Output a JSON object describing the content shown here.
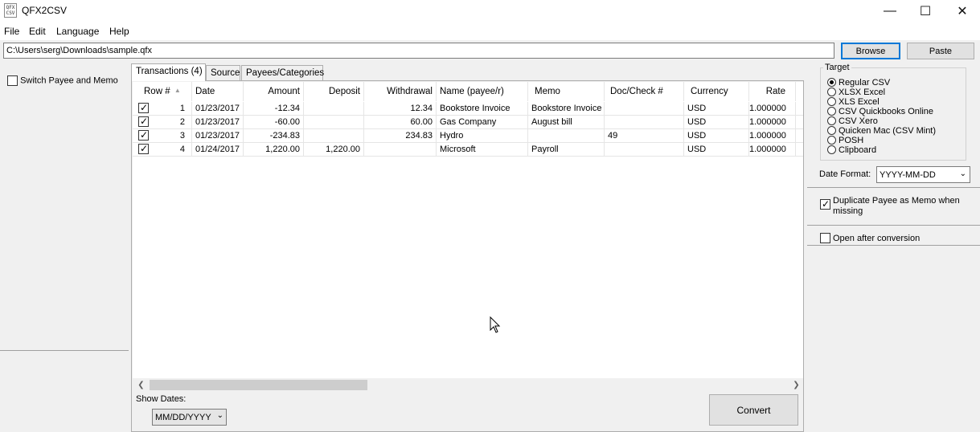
{
  "window": {
    "title": "QFX2CSV",
    "icon_text": "QFX CSV",
    "min_glyph": "—",
    "max_glyph": "☐",
    "close_glyph": "✕"
  },
  "menu": [
    "File",
    "Edit",
    "Language",
    "Help"
  ],
  "toolbar": {
    "path_value": "C:\\Users\\serg\\Downloads\\sample.qfx",
    "browse_label": "Browse",
    "paste_label": "Paste"
  },
  "left_panel": {
    "switch_label": "Switch Payee and Memo",
    "switch_checked": false
  },
  "tabs": [
    {
      "label": "Transactions (4)",
      "active": true
    },
    {
      "label": "Source",
      "active": false
    },
    {
      "label": "Payees/Categories",
      "active": false
    }
  ],
  "grid": {
    "columns": [
      "Row #",
      "Date",
      "Amount",
      "Deposit",
      "Withdrawal",
      "Name (payee/r)",
      "Memo",
      "Doc/Check #",
      "Currency",
      "Rate"
    ],
    "sort_glyph": "▲",
    "rows": [
      {
        "checked": true,
        "row": "1",
        "date": "01/23/2017",
        "amount": "-12.34",
        "deposit": "",
        "withdrawal": "12.34",
        "name": "Bookstore Invoice",
        "memo": "Bookstore Invoice",
        "doc": "",
        "currency": "USD",
        "rate": "1.000000"
      },
      {
        "checked": true,
        "row": "2",
        "date": "01/23/2017",
        "amount": "-60.00",
        "deposit": "",
        "withdrawal": "60.00",
        "name": "Gas Company",
        "memo": "August bill",
        "doc": "",
        "currency": "USD",
        "rate": "1.000000"
      },
      {
        "checked": true,
        "row": "3",
        "date": "01/23/2017",
        "amount": "-234.83",
        "deposit": "",
        "withdrawal": "234.83",
        "name": "Hydro",
        "memo": "",
        "doc": "49",
        "currency": "USD",
        "rate": "1.000000"
      },
      {
        "checked": true,
        "row": "4",
        "date": "01/24/2017",
        "amount": "1,220.00",
        "deposit": "1,220.00",
        "withdrawal": "",
        "name": "Microsoft",
        "memo": "Payroll",
        "doc": "",
        "currency": "USD",
        "rate": "1.000000"
      }
    ]
  },
  "bottom": {
    "show_dates_label": "Show Dates:",
    "show_dates_value": "MM/DD/YYYY",
    "convert_label": "Convert"
  },
  "right_panel": {
    "target_label": "Target",
    "targets": [
      {
        "label": "Regular CSV",
        "selected": true
      },
      {
        "label": "XLSX Excel",
        "selected": false
      },
      {
        "label": "XLS Excel",
        "selected": false
      },
      {
        "label": "CSV Quickbooks Online",
        "selected": false
      },
      {
        "label": "CSV Xero",
        "selected": false
      },
      {
        "label": "Quicken Mac (CSV Mint)",
        "selected": false
      },
      {
        "label": "POSH",
        "selected": false
      },
      {
        "label": "Clipboard",
        "selected": false
      }
    ],
    "date_format_label": "Date Format:",
    "date_format_value": "YYYY-MM-DD",
    "dup_payee_label": "Duplicate Payee as Memo when missing",
    "dup_payee_checked": true,
    "open_after_label": "Open after conversion",
    "open_after_checked": false
  }
}
